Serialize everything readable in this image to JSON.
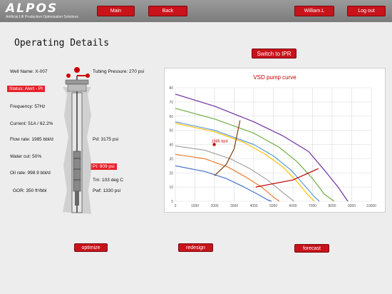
{
  "header": {
    "logo_text": "ALPOS",
    "tagline": "Artificial Lift Production Optimization Solutions",
    "main_label": "Main",
    "back_label": "Back",
    "user_label": "William.L",
    "logout_label": "Log out"
  },
  "page_title": "Operating Details",
  "switch_label": "Switch to IPR",
  "well": {
    "well_name": "Well Name: X-007",
    "tubing_pressure": "Tubing Pressure: 270 psi",
    "status": "Status: Alert - PI",
    "frequency": "Frequency: 57Hz",
    "current": "Current: 51A / 62.2%",
    "flow_rate": "Flow rate: 1985 bbl/d",
    "pd": "Pd: 3175  psi",
    "water_cut": "Water cut: 50%",
    "pi": "PI: 909  psi",
    "oil_rate": "Oil rate: 998.9  bbl/d",
    "tm": "Tm: 103  deg C",
    "gor": "GOR: 350 ft³/bbl",
    "pwf": "Pwf: 1330 psi"
  },
  "actions": {
    "optimize": "optimize",
    "redesign": "redesign",
    "forecast": "forecast"
  },
  "chart_data": {
    "type": "line",
    "title": "VSD pump curve",
    "xlim": [
      0,
      10000
    ],
    "ylim": [
      0,
      80
    ],
    "x_ticks": [
      "0",
      "1000",
      "2000",
      "3000",
      "4000",
      "5000",
      "6000",
      "7000",
      "8000",
      "9000",
      "10000"
    ],
    "y_ticks": [
      "0",
      "10",
      "20",
      "30",
      "40",
      "50",
      "60",
      "70",
      "80"
    ],
    "grid": true,
    "series": [
      {
        "color": "#7030a0",
        "points": [
          [
            0,
            75.5
          ],
          [
            2000,
            67
          ],
          [
            4000,
            56
          ],
          [
            5500,
            46
          ],
          [
            6800,
            35
          ],
          [
            7600,
            22
          ],
          [
            8300,
            10
          ],
          [
            8800,
            0
          ]
        ]
      },
      {
        "color": "#70ad47",
        "points": [
          [
            0,
            65.5
          ],
          [
            2000,
            58
          ],
          [
            4000,
            48
          ],
          [
            5300,
            38
          ],
          [
            6200,
            28
          ],
          [
            7000,
            16
          ],
          [
            7600,
            5
          ],
          [
            8100,
            0
          ]
        ]
      },
      {
        "color": "#ffc000",
        "points": [
          [
            0,
            55
          ],
          [
            2000,
            49
          ],
          [
            3500,
            41.5
          ],
          [
            4600,
            33
          ],
          [
            5500,
            24
          ],
          [
            6200,
            14
          ],
          [
            6800,
            4
          ],
          [
            7100,
            0
          ]
        ]
      },
      {
        "color": "#5b9bd5",
        "points": [
          [
            0,
            56
          ],
          [
            2000,
            50
          ],
          [
            4000,
            40
          ],
          [
            5000,
            32
          ],
          [
            5900,
            22
          ],
          [
            6600,
            11
          ],
          [
            7100,
            3
          ],
          [
            7350,
            0
          ]
        ]
      },
      {
        "color": "#a5a5a5",
        "points": [
          [
            0,
            39
          ],
          [
            1500,
            36
          ],
          [
            2800,
            30
          ],
          [
            3800,
            23
          ],
          [
            4700,
            15
          ],
          [
            5500,
            6
          ],
          [
            6050,
            0
          ]
        ]
      },
      {
        "color": "#ed7d31",
        "points": [
          [
            0,
            33
          ],
          [
            1500,
            30
          ],
          [
            2700,
            24
          ],
          [
            3600,
            17
          ],
          [
            4400,
            10
          ],
          [
            5000,
            3
          ],
          [
            5300,
            0
          ]
        ]
      },
      {
        "color": "#4472c4",
        "points": [
          [
            0,
            25
          ],
          [
            1500,
            21
          ],
          [
            2600,
            16
          ],
          [
            3500,
            10
          ],
          [
            4200,
            5
          ],
          [
            4700,
            1
          ],
          [
            4900,
            0
          ]
        ]
      },
      {
        "color": "#843c0c",
        "points": [
          [
            2000,
            18
          ],
          [
            2600,
            26
          ],
          [
            3000,
            37
          ],
          [
            3300,
            57
          ]
        ]
      },
      {
        "color": "#c00000",
        "points": [
          [
            4100,
            10
          ],
          [
            6000,
            15
          ],
          [
            7300,
            23
          ]
        ]
      }
    ],
    "operating_point": {
      "x": 1985,
      "y": 40,
      "label": "1985 bpd"
    }
  }
}
